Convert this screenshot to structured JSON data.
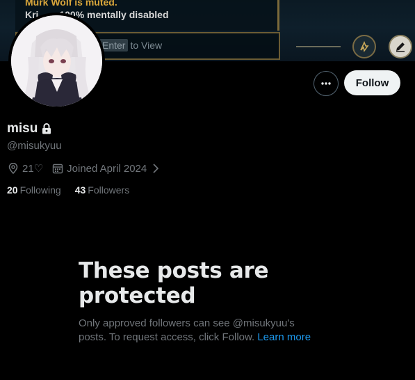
{
  "banner": {
    "chat_line_1": "Murk Wolf is muted.",
    "chat_line_2_name": "Kri",
    "chat_line_2_text": "100% mentally disabled",
    "input_key": "Enter",
    "input_hint": "to View"
  },
  "actions": {
    "more_icon": "more-dots-icon",
    "follow_label": "Follow"
  },
  "profile": {
    "display_name": "misu",
    "lock_icon": "lock-icon",
    "handle": "@misukyuu",
    "location": "21♡",
    "location_icon": "location-pin-icon",
    "joined": "Joined April 2024",
    "joined_icon": "calendar-icon",
    "following_count": "20",
    "following_label": "Following",
    "followers_count": "43",
    "followers_label": "Followers"
  },
  "protected": {
    "title": "These posts are protected",
    "description": "Only approved followers can see @misukyuu's posts. To request access, click Follow.",
    "learn_more": "Learn more"
  },
  "colors": {
    "background": "#000000",
    "primary_text": "#e7e9ea",
    "secondary_text": "#71767b",
    "link": "#1d9bf0",
    "follow_button_bg": "#eff3f4"
  }
}
